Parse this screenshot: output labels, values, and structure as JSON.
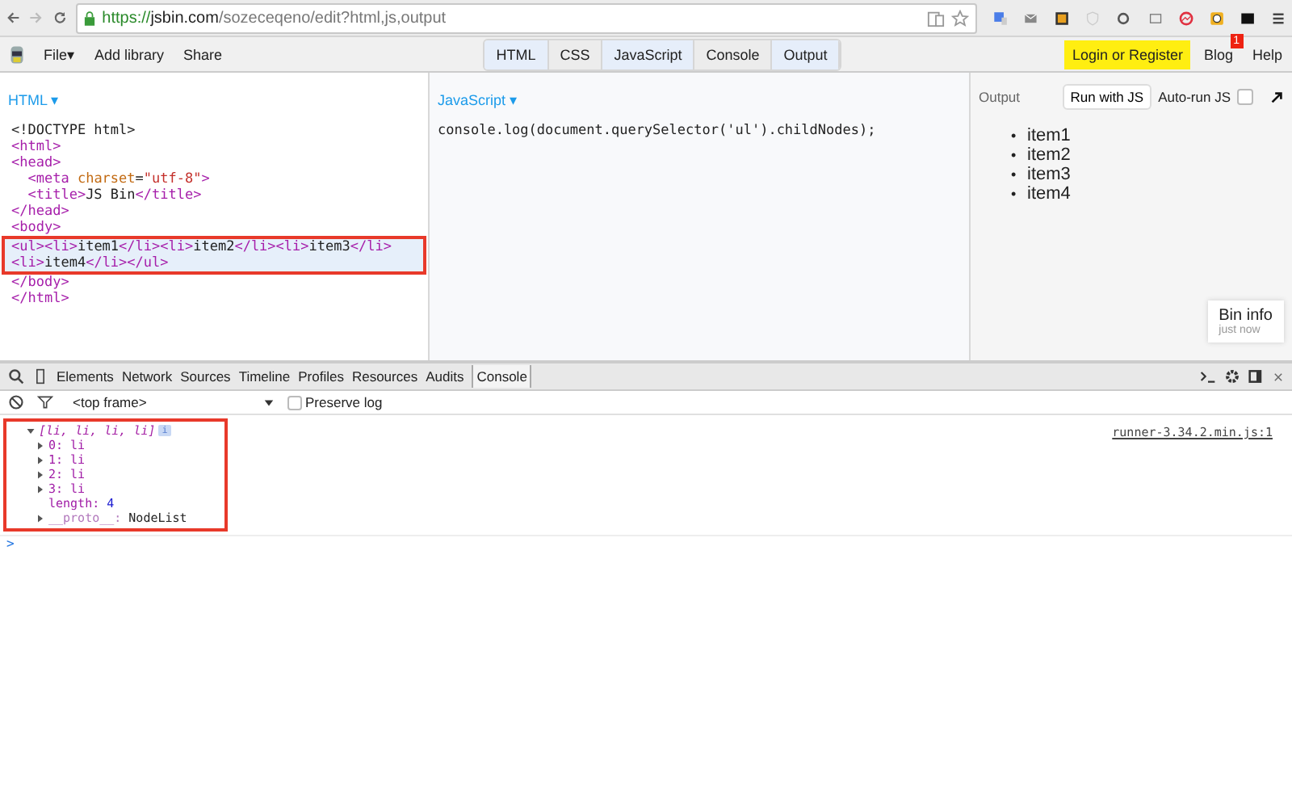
{
  "browser": {
    "url_scheme": "https://",
    "url_host": "jsbin.com",
    "url_path": "/sozeceqeno/edit?html,js,output"
  },
  "toolbar": {
    "menu": [
      {
        "label": "File",
        "caret": "▾"
      },
      {
        "label": "Add library"
      },
      {
        "label": "Share"
      }
    ],
    "panels": [
      {
        "label": "HTML",
        "selected": true
      },
      {
        "label": "CSS",
        "selected": false
      },
      {
        "label": "JavaScript",
        "selected": true
      },
      {
        "label": "Console",
        "selected": false
      },
      {
        "label": "Output",
        "selected": true
      }
    ],
    "login": "Login or Register",
    "blog": "Blog",
    "blog_badge": "1",
    "help": "Help"
  },
  "html_panel": {
    "title": "HTML",
    "caret": "▾",
    "lines": [
      {
        "highlighted": false,
        "tokens": [
          {
            "kind": "text",
            "t": "<!DOCTYPE html>"
          }
        ]
      },
      {
        "highlighted": false,
        "tokens": [
          {
            "kind": "tag",
            "t": "<html>"
          }
        ]
      },
      {
        "highlighted": false,
        "tokens": [
          {
            "kind": "tag",
            "t": "<head>"
          }
        ]
      },
      {
        "highlighted": false,
        "tokens": [
          {
            "kind": "tag",
            "t": "  <meta "
          },
          {
            "kind": "attr",
            "t": "charset"
          },
          {
            "kind": "text",
            "t": "="
          },
          {
            "kind": "str",
            "t": "\"utf-8\""
          },
          {
            "kind": "tag",
            "t": ">"
          }
        ]
      },
      {
        "highlighted": false,
        "tokens": [
          {
            "kind": "tag",
            "t": "  <title>"
          },
          {
            "kind": "text",
            "t": "JS Bin"
          },
          {
            "kind": "tag",
            "t": "</title>"
          }
        ]
      },
      {
        "highlighted": false,
        "tokens": [
          {
            "kind": "tag",
            "t": "</head>"
          }
        ]
      },
      {
        "highlighted": false,
        "tokens": [
          {
            "kind": "tag",
            "t": "<body>"
          }
        ]
      },
      {
        "highlighted": true,
        "tokens": [
          {
            "kind": "tag",
            "t": "<ul><li>"
          },
          {
            "kind": "text",
            "t": "item1"
          },
          {
            "kind": "tag",
            "t": "</li><li>"
          },
          {
            "kind": "text",
            "t": "item2"
          },
          {
            "kind": "tag",
            "t": "</li><li>"
          },
          {
            "kind": "text",
            "t": "item3"
          },
          {
            "kind": "tag",
            "t": "</li>"
          }
        ]
      },
      {
        "highlighted": true,
        "tokens": [
          {
            "kind": "tag",
            "t": "<li>"
          },
          {
            "kind": "text",
            "t": "item4"
          },
          {
            "kind": "tag",
            "t": "</li></ul>"
          }
        ]
      },
      {
        "highlighted": false,
        "tokens": [
          {
            "kind": "tag",
            "t": "</body>"
          }
        ]
      },
      {
        "highlighted": false,
        "tokens": [
          {
            "kind": "tag",
            "t": "</html>"
          }
        ]
      }
    ]
  },
  "js_panel": {
    "title": "JavaScript",
    "caret": "▾",
    "code": "console.log(document.querySelector('ul').childNodes);"
  },
  "output_panel": {
    "title": "Output",
    "run_button": "Run with JS",
    "autorun_label": "Auto-run JS",
    "autorun": false,
    "items": [
      {
        "marker": "•",
        "text": "item1"
      },
      {
        "marker": "•",
        "text": "item2"
      },
      {
        "marker": "•",
        "text": "item3"
      },
      {
        "marker": "•",
        "text": "item4"
      }
    ],
    "bin_info": "Bin info",
    "bin_time": "just now"
  },
  "devtools": {
    "tabs": [
      {
        "label": "Elements",
        "selected": false
      },
      {
        "label": "Network",
        "selected": false
      },
      {
        "label": "Sources",
        "selected": false
      },
      {
        "label": "Timeline",
        "selected": false
      },
      {
        "label": "Profiles",
        "selected": false
      },
      {
        "label": "Resources",
        "selected": false
      },
      {
        "label": "Audits",
        "selected": false
      },
      {
        "label": "Console",
        "selected": true
      }
    ],
    "frame": "<top frame>",
    "preserve_log_label": "Preserve log",
    "preserve_log": false,
    "entry": {
      "summary": "[li, li, li, li]",
      "info": "i",
      "expanded": true,
      "source": "runner-3.34.2.min.js:1",
      "children": [
        {
          "key": "0:",
          "value": "li",
          "kind": "node",
          "expanded": false
        },
        {
          "key": "1:",
          "value": "li",
          "kind": "node",
          "expanded": false
        },
        {
          "key": "2:",
          "value": "li",
          "kind": "node",
          "expanded": false
        },
        {
          "key": "3:",
          "value": "li",
          "kind": "node",
          "expanded": false
        },
        {
          "key": "length:",
          "value": "4",
          "kind": "number"
        },
        {
          "key": "__proto__:",
          "value": "NodeList",
          "kind": "proto",
          "expanded": false
        }
      ]
    },
    "prompt": ">"
  }
}
